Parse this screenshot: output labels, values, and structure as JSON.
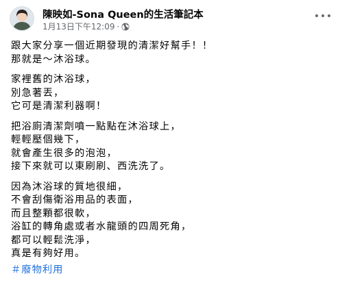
{
  "post": {
    "author": "陳映如-Sona Queen的生活筆記本",
    "timestamp": "1月13日下午12:09",
    "separator": "·",
    "privacy_icon": "globe-icon",
    "menu_icon": "more-options-icon",
    "paragraphs": [
      [
        "跟大家分享一個近期發現的清潔好幫手！！",
        "那就是～沐浴球。"
      ],
      [
        "家裡舊的沐浴球，",
        "別急著丟，",
        "它可是清潔利器啊！"
      ],
      [
        "把浴廁清潔劑噴一點點在沐浴球上，",
        "輕輕壓個幾下，",
        "就會產生很多的泡泡，",
        "接下來就可以東刷刷、西洗洗了。"
      ],
      [
        "因為沐浴球的質地很細，",
        "不會刮傷衛浴用品的表面，",
        "而且整顆都很軟，",
        "浴缸的轉角處或者水龍頭的四周死角，",
        "都可以輕鬆洗淨，",
        "真是有夠好用。"
      ]
    ],
    "hashtag": "＃廢物利用"
  },
  "colors": {
    "text": "#050505",
    "secondary_text": "#65676b",
    "link": "#216fdb"
  }
}
